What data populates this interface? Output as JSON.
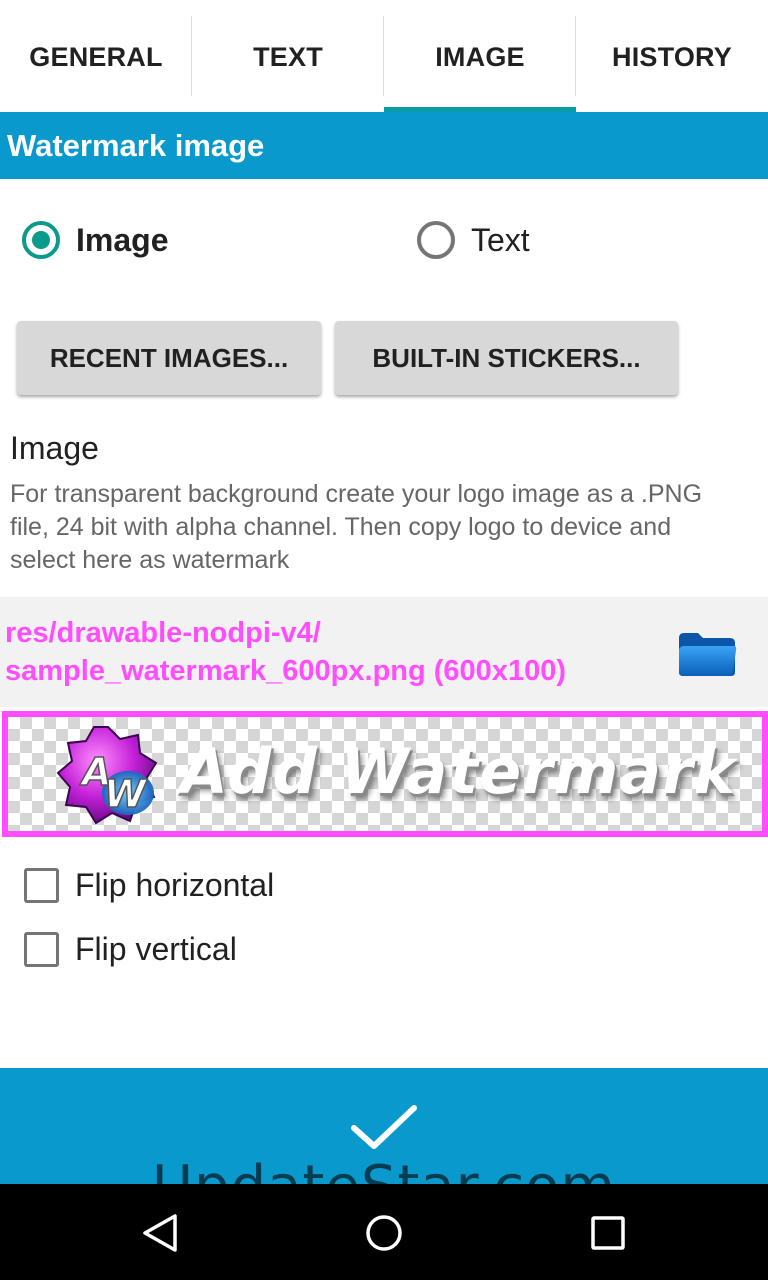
{
  "tabs": [
    {
      "label": "GENERAL",
      "active": false
    },
    {
      "label": "TEXT",
      "active": false
    },
    {
      "label": "IMAGE",
      "active": true
    },
    {
      "label": "HISTORY",
      "active": false
    }
  ],
  "section_header": "Watermark image",
  "source_type": {
    "options": [
      {
        "label": "Image",
        "checked": true
      },
      {
        "label": "Text",
        "checked": false
      }
    ]
  },
  "buttons": {
    "recent_images": "RECENT IMAGES...",
    "built_in_stickers": "BUILT-IN STICKERS..."
  },
  "image_setting": {
    "title": "Image",
    "description": "For transparent background create your logo image as a .PNG file, 24 bit with alpha channel. Then copy logo to device and select here as watermark"
  },
  "selected_file": {
    "path_line1": "res/drawable-nodpi-v4/",
    "path_line2": "sample_watermark_600px.png (600x100)",
    "browse_icon": "folder-icon"
  },
  "preview": {
    "logo_letters": "AW",
    "text": "Add Watermark"
  },
  "options": [
    {
      "label": "Flip horizontal",
      "checked": false
    },
    {
      "label": "Flip vertical",
      "checked": false
    }
  ],
  "confirm_icon": "checkmark-icon",
  "overlay_watermark": "UpdateStar.com",
  "nav": [
    "back-icon",
    "home-icon",
    "recents-icon"
  ],
  "colors": {
    "accent": "#0a99cc",
    "radio_checked": "#0a9a8c",
    "path_text": "#ff4dff",
    "preview_border": "#ff4dff"
  }
}
